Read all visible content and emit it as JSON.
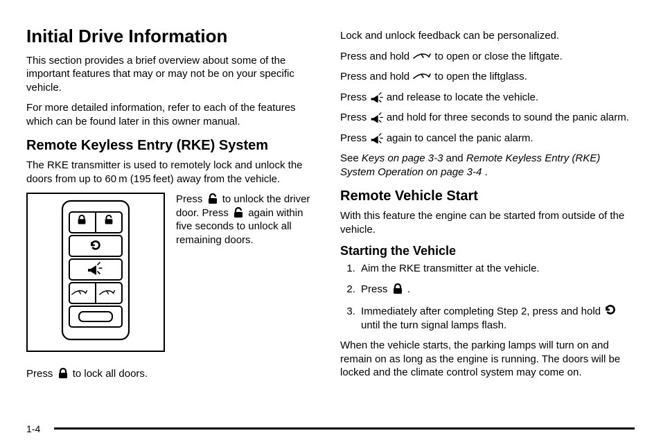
{
  "left": {
    "h1": "Initial Drive Information",
    "p1": "This section provides a brief overview about some of the important features that may or may not be on your specific vehicle.",
    "p2": "For more detailed information, refer to each of the features which can be found later in this owner manual.",
    "h2": "Remote Keyless Entry (RKE) System",
    "p3": "The RKE transmitter is used to remotely lock and unlock the doors from up to 60 m (195 feet) away from the vehicle.",
    "side1": "Press ",
    "side2": " to unlock the driver door. Press ",
    "side3": " again within five seconds to unlock all remaining doors.",
    "p4a": "Press ",
    "p4b": " to lock all doors."
  },
  "right": {
    "p1": "Lock and unlock feedback can be personalized.",
    "p2a": "Press and hold ",
    "p2b": " to open or close the liftgate.",
    "p3a": "Press and hold ",
    "p3b": " to open the liftglass.",
    "p4a": "Press ",
    "p4b": " and release to locate the vehicle.",
    "p5a": "Press ",
    "p5b": " and hold for three seconds to sound the panic alarm.",
    "p6a": "Press ",
    "p6b": " again to cancel the panic alarm.",
    "p7a": "See ",
    "p7b": "Keys on page 3‑3",
    "p7c": " and ",
    "p7d": "Remote Keyless Entry (RKE) System Operation on page 3‑4",
    "p7e": ".",
    "h2": "Remote Vehicle Start",
    "p8": "With this feature the engine can be started from outside of the vehicle.",
    "h3": "Starting the Vehicle",
    "li1": "Aim the RKE transmitter at the vehicle.",
    "li2a": "Press ",
    "li2b": " .",
    "li3a": "Immediately after completing Step 2, press and hold ",
    "li3b": " until the turn signal lamps flash.",
    "p9": "When the vehicle starts, the parking lamps will turn on and remain on as long as the engine is running. The doors will be locked and the climate control system may come on."
  },
  "footer": {
    "page": "1-4"
  }
}
